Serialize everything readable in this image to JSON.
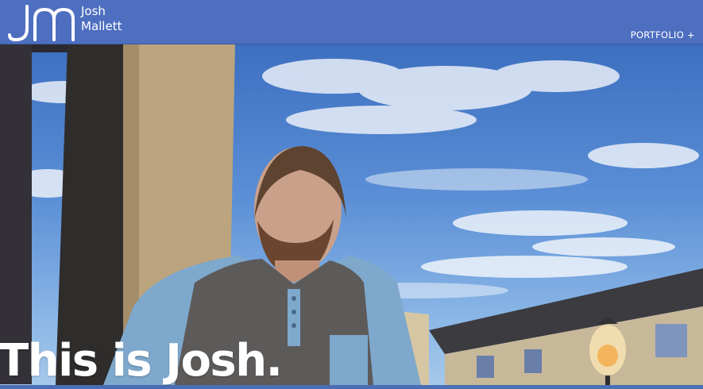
{
  "header": {
    "logo_first_name": "Josh",
    "logo_last_name": "Mallett",
    "nav_portfolio": "PORTFOLIO +"
  },
  "hero": {
    "headline": "This is Josh.",
    "image_icon": "portrait-photo"
  },
  "colors": {
    "header_bg": "#4e6fc0",
    "text": "#ffffff",
    "sky": "#5b8fd6"
  }
}
